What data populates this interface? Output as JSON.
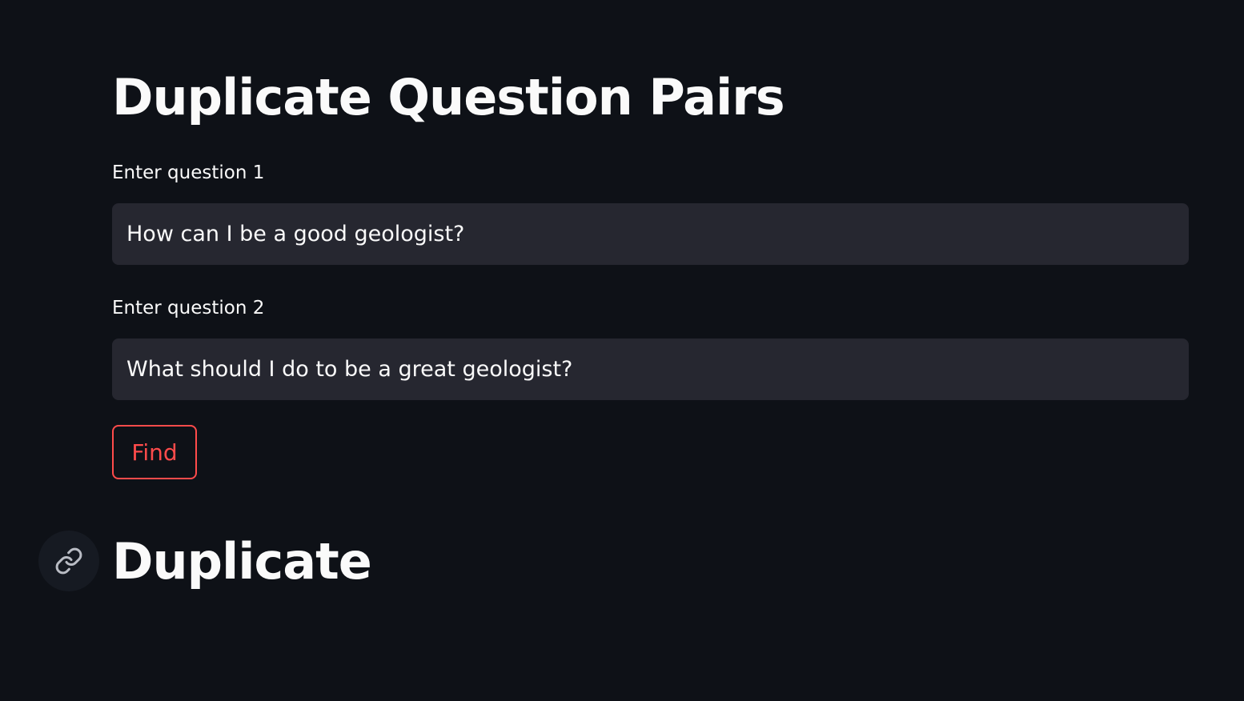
{
  "app": {
    "title": "Duplicate Question Pairs"
  },
  "form": {
    "question1_label": "Enter question 1",
    "question1_value": "How can I be a good geologist?",
    "question2_label": "Enter question 2",
    "question2_value": "What should I do to be a great geologist?",
    "submit_label": "Find"
  },
  "result": {
    "heading": "Duplicate",
    "anchor_icon": "link-icon"
  },
  "colors": {
    "background": "#0e1117",
    "input_background": "#262730",
    "accent": "#ff4b4b",
    "text": "#fafafa"
  }
}
